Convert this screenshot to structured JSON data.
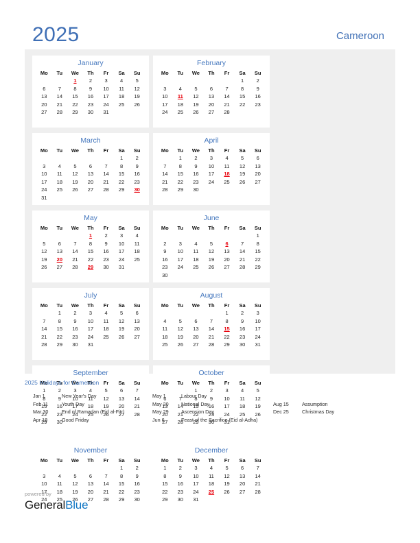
{
  "header": {
    "year": "2025",
    "country": "Cameroon"
  },
  "calendar": {
    "weekday_headers": [
      "Mo",
      "Tu",
      "We",
      "Th",
      "Fr",
      "Sa",
      "Su"
    ],
    "months": [
      {
        "name": "January",
        "start_weekday_index": 2,
        "days_in_month": 31,
        "holidays": [
          1
        ]
      },
      {
        "name": "February",
        "start_weekday_index": 5,
        "days_in_month": 28,
        "holidays": [
          11
        ]
      },
      {
        "name": "March",
        "start_weekday_index": 5,
        "days_in_month": 31,
        "holidays": [
          30
        ]
      },
      {
        "name": "April",
        "start_weekday_index": 1,
        "days_in_month": 30,
        "holidays": [
          18
        ]
      },
      {
        "name": "May",
        "start_weekday_index": 3,
        "days_in_month": 31,
        "holidays": [
          1,
          20,
          29
        ]
      },
      {
        "name": "June",
        "start_weekday_index": 6,
        "days_in_month": 30,
        "holidays": [
          6
        ]
      },
      {
        "name": "July",
        "start_weekday_index": 1,
        "days_in_month": 31,
        "holidays": []
      },
      {
        "name": "August",
        "start_weekday_index": 4,
        "days_in_month": 31,
        "holidays": [
          15
        ]
      },
      {
        "name": "September",
        "start_weekday_index": 0,
        "days_in_month": 30,
        "holidays": []
      },
      {
        "name": "October",
        "start_weekday_index": 2,
        "days_in_month": 31,
        "holidays": []
      },
      {
        "name": "November",
        "start_weekday_index": 5,
        "days_in_month": 30,
        "holidays": []
      },
      {
        "name": "December",
        "start_weekday_index": 0,
        "days_in_month": 31,
        "holidays": [
          25
        ]
      }
    ]
  },
  "holidays_legend": {
    "title": "2025 Holidays for Cameroon",
    "columns": [
      [
        {
          "date": "Jan 1",
          "name": "New Year's Day"
        },
        {
          "date": "Feb 11",
          "name": "Youth Day"
        },
        {
          "date": "Mar 30",
          "name": "End of Ramadan (Eid al-Fitr)"
        },
        {
          "date": "Apr 18",
          "name": "Good Friday"
        }
      ],
      [
        {
          "date": "May 1",
          "name": "Labour Day"
        },
        {
          "date": "May 20",
          "name": "National Day"
        },
        {
          "date": "May 29",
          "name": "Ascension Day"
        },
        {
          "date": "Jun 6",
          "name": "Feast of the Sacrifice (Eid al-Adha)"
        }
      ],
      [
        {
          "date": "Aug 15",
          "name": "Assumption"
        },
        {
          "date": "Dec 25",
          "name": "Christmas Day"
        }
      ]
    ],
    "column_offsets": [
      0,
      0,
      1
    ]
  },
  "footer": {
    "powered_by": "powered by",
    "brand_first": "General",
    "brand_second": "Blue"
  },
  "colors": {
    "accent_blue": "#4678be",
    "holiday_red": "#e8000b",
    "panel_gray": "#efefef",
    "brand_blue": "#1277c4"
  }
}
